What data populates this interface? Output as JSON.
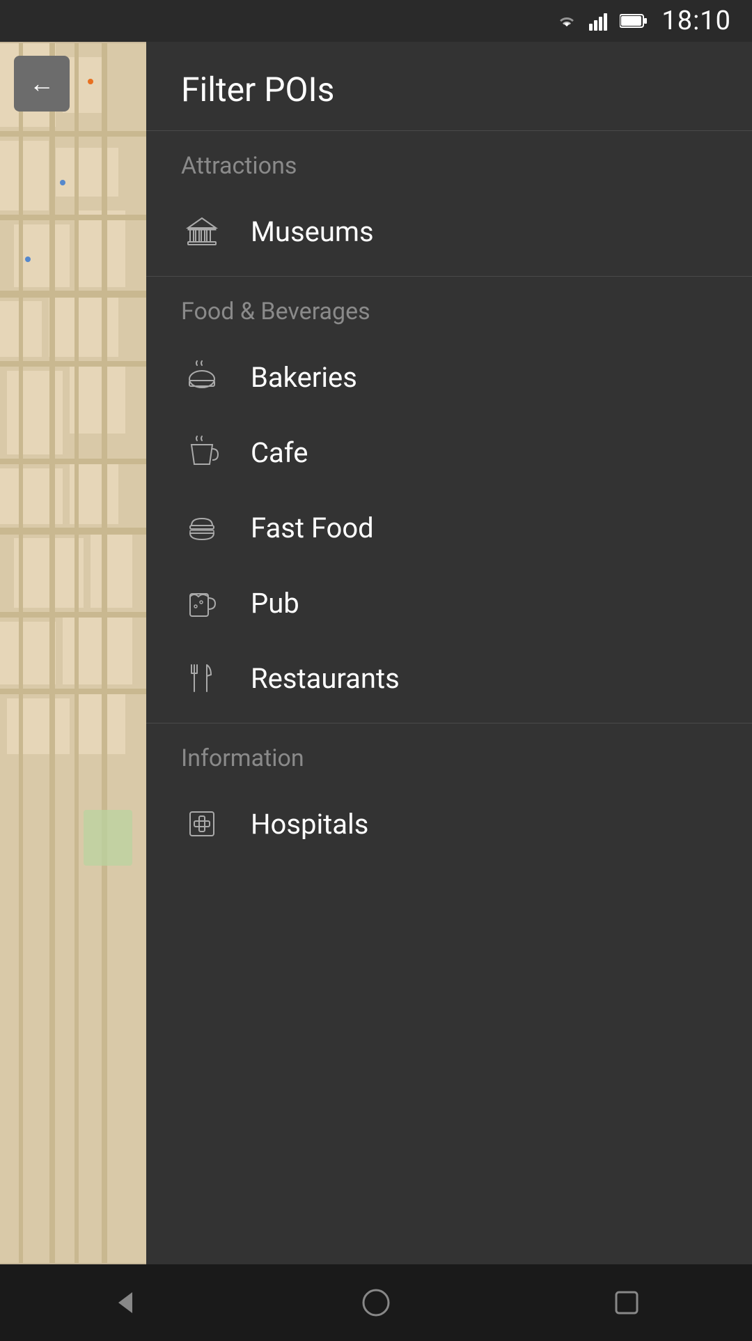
{
  "statusBar": {
    "time": "18:10"
  },
  "header": {
    "title": "Filter POIs"
  },
  "sections": [
    {
      "id": "attractions",
      "label": "Attractions",
      "items": [
        {
          "id": "museums",
          "label": "Museums",
          "icon": "museum"
        }
      ]
    },
    {
      "id": "food-beverages",
      "label": "Food & Beverages",
      "items": [
        {
          "id": "bakeries",
          "label": "Bakeries",
          "icon": "bakery"
        },
        {
          "id": "cafe",
          "label": "Cafe",
          "icon": "cafe"
        },
        {
          "id": "fast-food",
          "label": "Fast Food",
          "icon": "fastfood"
        },
        {
          "id": "pub",
          "label": "Pub",
          "icon": "pub"
        },
        {
          "id": "restaurants",
          "label": "Restaurants",
          "icon": "restaurant"
        }
      ]
    },
    {
      "id": "information",
      "label": "Information",
      "items": [
        {
          "id": "hospitals",
          "label": "Hospitals",
          "icon": "hospital"
        }
      ]
    }
  ],
  "backButton": "←",
  "nav": {
    "back": "back",
    "home": "home",
    "recent": "recent"
  }
}
